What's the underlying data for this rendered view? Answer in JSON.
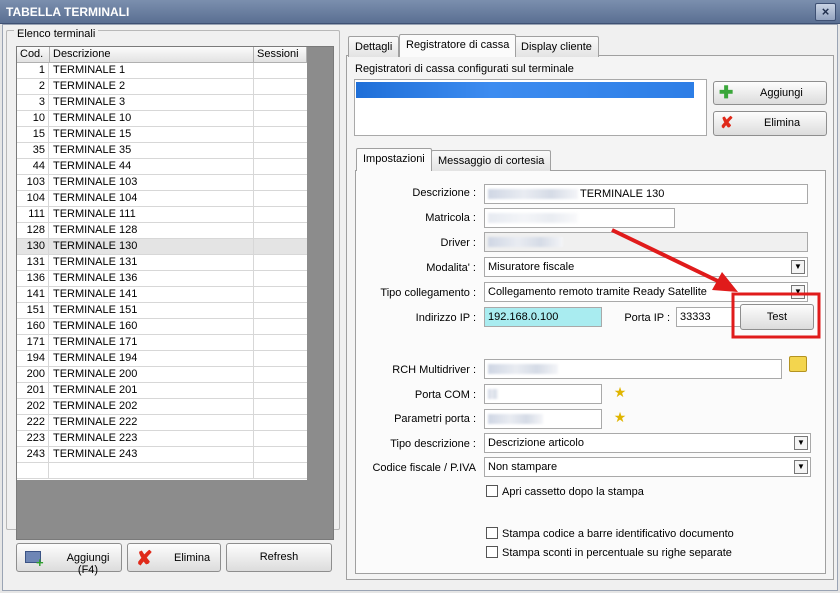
{
  "window": {
    "title": "TABELLA TERMINALI",
    "close_glyph": "×"
  },
  "terminals": {
    "group_label": "Elenco terminali",
    "columns": [
      "Cod.",
      "Descrizione",
      "Sessioni"
    ],
    "rows": [
      {
        "cod": "1",
        "desc": "TERMINALE 1"
      },
      {
        "cod": "2",
        "desc": "TERMINALE 2"
      },
      {
        "cod": "3",
        "desc": "TERMINALE 3"
      },
      {
        "cod": "10",
        "desc": "TERMINALE 10"
      },
      {
        "cod": "15",
        "desc": "TERMINALE 15"
      },
      {
        "cod": "35",
        "desc": "TERMINALE 35"
      },
      {
        "cod": "44",
        "desc": "TERMINALE 44"
      },
      {
        "cod": "103",
        "desc": "TERMINALE 103"
      },
      {
        "cod": "104",
        "desc": "TERMINALE 104"
      },
      {
        "cod": "111",
        "desc": "TERMINALE 111"
      },
      {
        "cod": "128",
        "desc": "TERMINALE 128"
      },
      {
        "cod": "130",
        "desc": "TERMINALE 130"
      },
      {
        "cod": "131",
        "desc": "TERMINALE 131"
      },
      {
        "cod": "136",
        "desc": "TERMINALE 136"
      },
      {
        "cod": "141",
        "desc": "TERMINALE 141"
      },
      {
        "cod": "151",
        "desc": "TERMINALE 151"
      },
      {
        "cod": "160",
        "desc": "TERMINALE 160"
      },
      {
        "cod": "171",
        "desc": "TERMINALE 171"
      },
      {
        "cod": "194",
        "desc": "TERMINALE 194"
      },
      {
        "cod": "200",
        "desc": "TERMINALE 200"
      },
      {
        "cod": "201",
        "desc": "TERMINALE 201"
      },
      {
        "cod": "202",
        "desc": "TERMINALE 202"
      },
      {
        "cod": "222",
        "desc": "TERMINALE 222"
      },
      {
        "cod": "223",
        "desc": "TERMINALE 223"
      },
      {
        "cod": "243",
        "desc": "TERMINALE 243"
      }
    ],
    "selected_cod": "130"
  },
  "bottom_buttons": {
    "add": "Aggiungi (F4)",
    "delete": "Elimina",
    "refresh": "Refresh"
  },
  "tabs": [
    "Dettagli",
    "Registratore di cassa",
    "Display cliente"
  ],
  "active_tab": "Registratore di cassa",
  "registers": {
    "heading": "Registratori di cassa configurati sul terminale",
    "add": "Aggiungi",
    "delete": "Elimina"
  },
  "subtabs": [
    "Impostazioni",
    "Messaggio di cortesia"
  ],
  "form": {
    "descrizione_label": "Descrizione :",
    "descrizione_value": "TERMINALE 130",
    "matricola_label": "Matricola :",
    "driver_label": "Driver :",
    "modalita_label": "Modalita' :",
    "modalita_value": "Misuratore fiscale",
    "tipo_collegamento_label": "Tipo collegamento :",
    "tipo_collegamento_value": "Collegamento remoto tramite Ready Satellite",
    "indirizzo_ip_label": "Indirizzo IP :",
    "indirizzo_ip_value": "192.168.0.100",
    "porta_ip_label": "Porta IP :",
    "porta_ip_value": "33333",
    "test_label": "Test",
    "rch_label": "RCH Multidriver :",
    "porta_com_label": "Porta COM :",
    "parametri_porta_label": "Parametri porta :",
    "tipo_descrizione_label": "Tipo descrizione :",
    "tipo_descrizione_value": "Descrizione articolo",
    "codice_fiscale_label": "Codice fiscale / P.IVA",
    "codice_fiscale_value": "Non stampare",
    "chk_cassetto": "Apri cassetto dopo la stampa",
    "chk_barcode": "Stampa codice a barre identificativo documento",
    "chk_sconti": "Stampa sconti in percentuale su righe separate"
  },
  "colors": {
    "annotation": "#e01b1b",
    "ip_highlight": "#a9ecf0"
  }
}
